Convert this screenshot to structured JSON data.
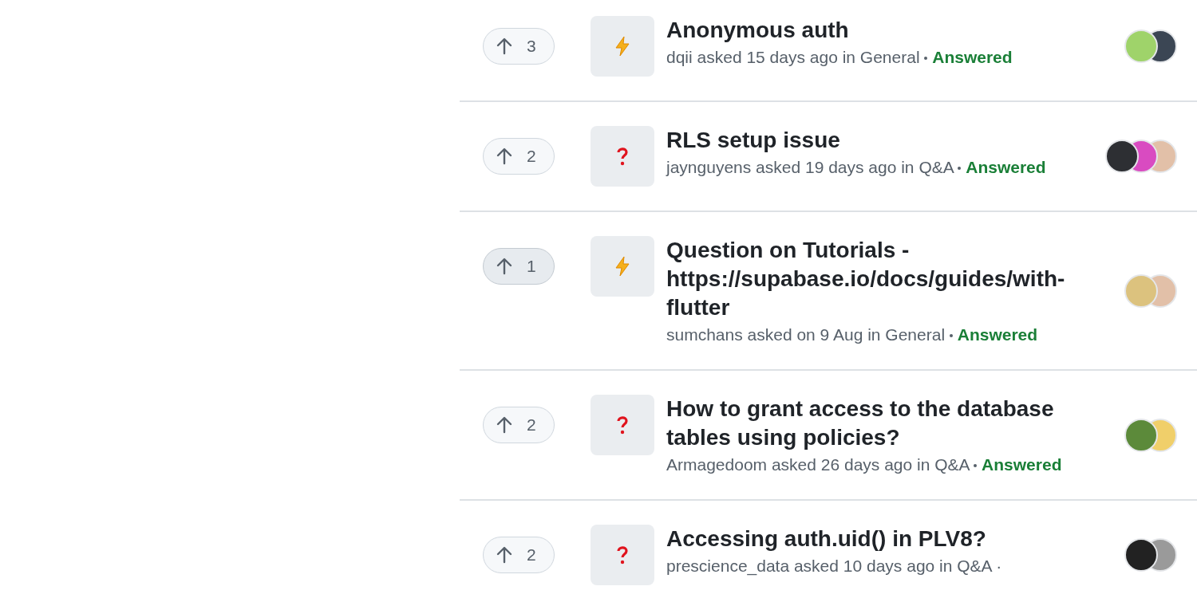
{
  "discussions": [
    {
      "votes": "3",
      "upvoted": false,
      "kind": "lightning",
      "title": "Anonymous auth",
      "meta": "dqii asked 15 days ago in General",
      "status": "Answered",
      "avatars": [
        {
          "color": "#9fd36a"
        },
        {
          "color": "#3b4654"
        }
      ]
    },
    {
      "votes": "2",
      "upvoted": false,
      "kind": "question",
      "title": "RLS setup issue",
      "meta": "jaynguyens asked 19 days ago in Q&A",
      "status": "Answered",
      "avatars": [
        {
          "color": "#2d2f33"
        },
        {
          "color": "#d94bc1"
        },
        {
          "color": "#e2c0a8"
        }
      ]
    },
    {
      "votes": "1",
      "upvoted": true,
      "kind": "lightning",
      "title": "Question on Tutorials - https://supabase.io/docs/guides/with-flutter",
      "meta": "sumchans asked on 9 Aug in General",
      "status": "Answered",
      "avatars": [
        {
          "color": "#dcc27e"
        },
        {
          "color": "#e2c0a8"
        }
      ]
    },
    {
      "votes": "2",
      "upvoted": false,
      "kind": "question",
      "title": "How to grant access to the database tables using policies?",
      "meta": "Armagedoom asked 26 days ago in Q&A",
      "status": "Answered",
      "avatars": [
        {
          "color": "#5c8a3a"
        },
        {
          "color": "#f0cf6a"
        }
      ]
    },
    {
      "votes": "2",
      "upvoted": false,
      "kind": "question",
      "title": "Accessing auth.uid() in PLV8?",
      "meta": "prescience_data asked 10 days ago in Q&A ·",
      "avatars": [
        {
          "color": "#222222"
        },
        {
          "color": "#9a9a9a"
        }
      ]
    }
  ]
}
